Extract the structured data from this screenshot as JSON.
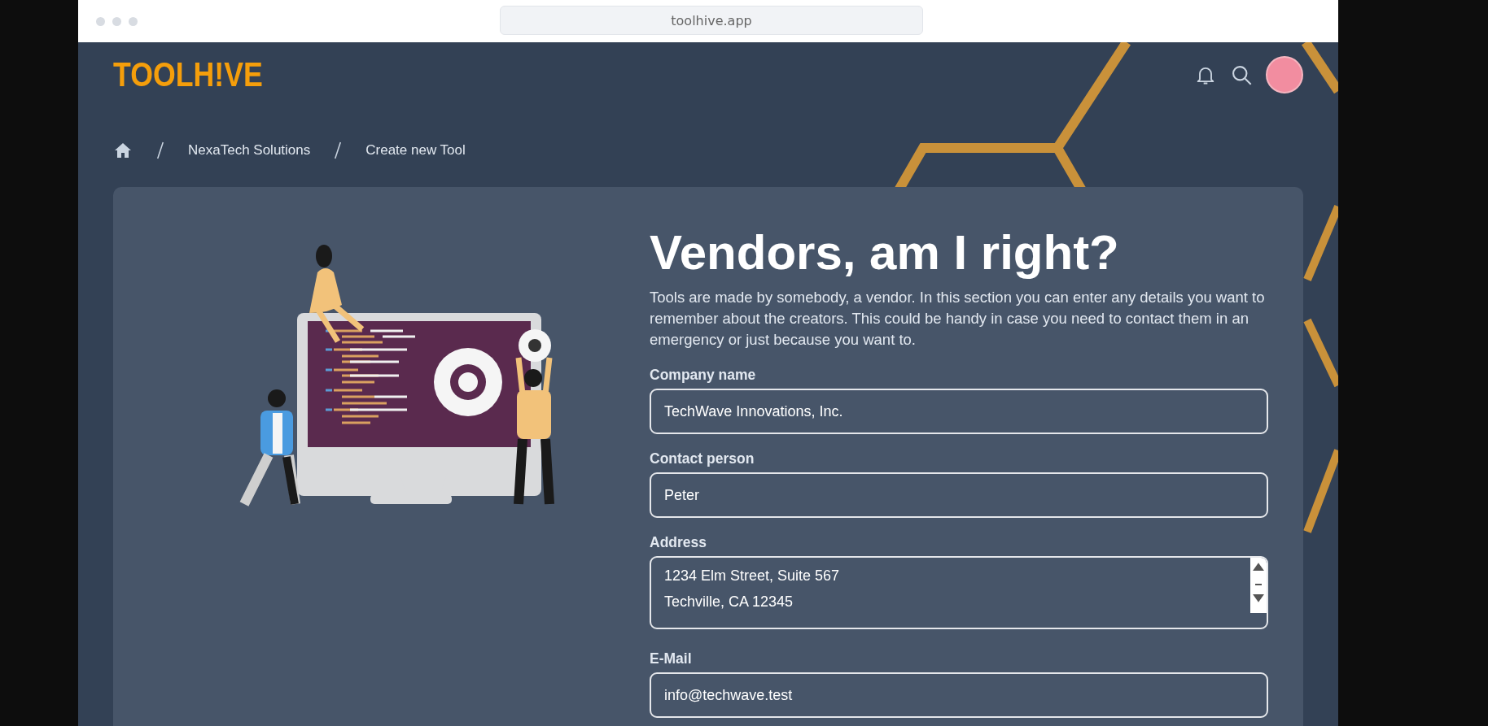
{
  "browser": {
    "url": "toolhive.app"
  },
  "header": {
    "logo": "TOOLH!VE"
  },
  "breadcrumb": [
    {
      "label": "NexaTech Solutions"
    },
    {
      "label": "Create new Tool"
    }
  ],
  "section": {
    "title": "Vendors, am I right?",
    "description": "Tools are made by somebody, a vendor. In this section you can enter any details you want to remember about the creators. This could be handy in case you need to contact them in an emergency or just because you want to."
  },
  "fields": [
    {
      "kind": "input",
      "label": "Company name",
      "value": "TechWave Innovations, Inc."
    },
    {
      "kind": "input",
      "label": "Contact person",
      "value": "Peter"
    },
    {
      "kind": "textarea",
      "label": "Address",
      "value": "1234 Elm Street, Suite 567\nTechville, CA 12345"
    },
    {
      "kind": "input",
      "label": "E-Mail",
      "value": "info@techwave.test"
    }
  ]
}
